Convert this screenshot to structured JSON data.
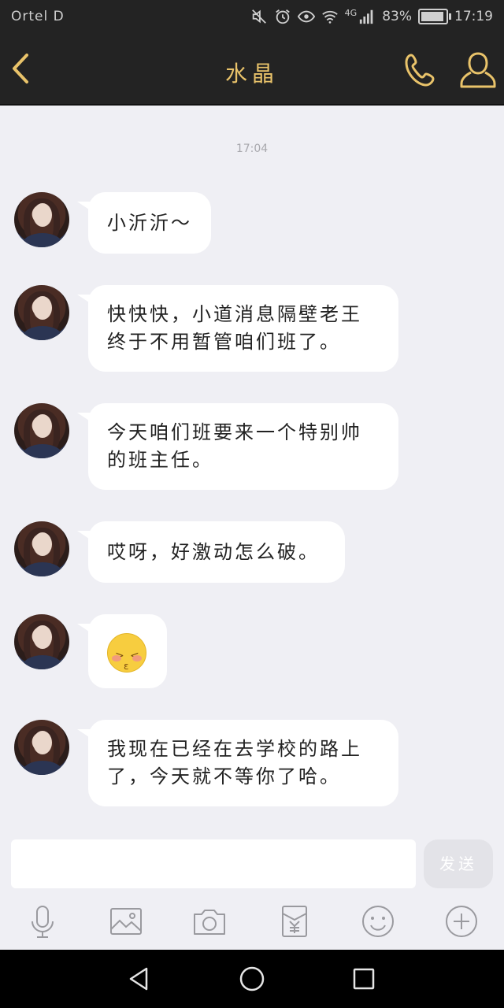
{
  "status_bar": {
    "carrier": "Ortel D",
    "network": "4G",
    "battery": "83%",
    "time": "17:19"
  },
  "header": {
    "title": "水晶"
  },
  "chat": {
    "timestamp": "17:04",
    "messages": [
      {
        "text": "小沂沂～"
      },
      {
        "text": "快快快，小道消息隔壁老王终于不用暂管咱们班了。"
      },
      {
        "text": "今天咱们班要来一个特别帅的班主任。"
      },
      {
        "text": "哎呀，好激动怎么破。"
      },
      {
        "emoji": "laughing-face"
      },
      {
        "text": "我现在已经在去学校的路上了，今天就不等你了哈。"
      }
    ]
  },
  "input": {
    "value": "",
    "send_label": "发送"
  },
  "toolbar": {
    "items": [
      "voice",
      "image",
      "camera",
      "red-packet",
      "emoji",
      "more"
    ]
  },
  "colors": {
    "header_bg": "#232323",
    "accent_gold": "#e9c36a",
    "chat_bg": "#efeff4",
    "bubble_bg": "#ffffff"
  }
}
